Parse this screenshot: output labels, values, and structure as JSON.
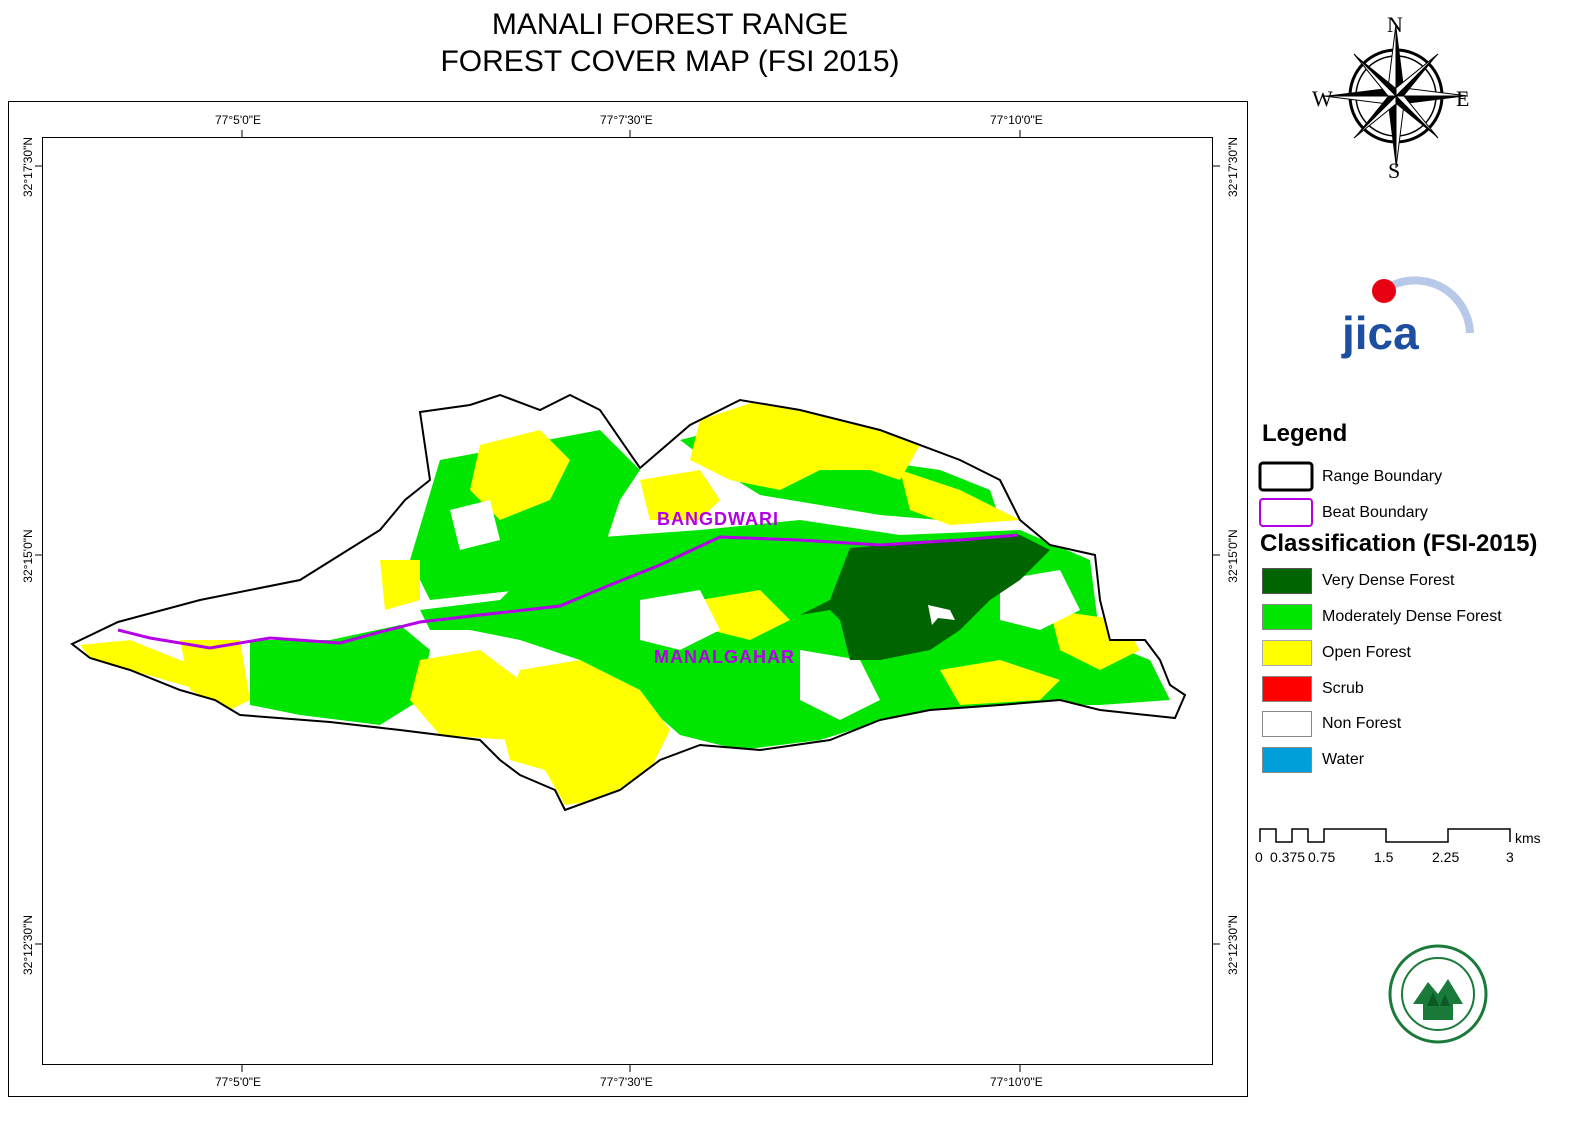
{
  "title": {
    "line1": "MANALI FOREST RANGE",
    "line2": "FOREST COVER MAP (FSI 2015)"
  },
  "grid": {
    "lon_labels": [
      "77°5'0\"E",
      "77°7'30\"E",
      "77°10'0\"E"
    ],
    "lat_labels": [
      "32°17'30\"N",
      "32°15'0\"N",
      "32°12'30\"N"
    ]
  },
  "map_labels": {
    "beat1": "BANGDWARI",
    "beat2": "MANALGAHAR"
  },
  "compass": {
    "n": "N",
    "s": "S",
    "e": "E",
    "w": "W"
  },
  "logo": {
    "text": "jica"
  },
  "legend": {
    "title": "Legend",
    "boundaries": [
      {
        "label": "Range Boundary",
        "color": "#000000"
      },
      {
        "label": "Beat Boundary",
        "color": "#b400e6"
      }
    ],
    "classification_title": "Classification (FSI-2015)",
    "classes": [
      {
        "label": "Very Dense Forest",
        "color": "#006400"
      },
      {
        "label": "Moderately Dense Forest",
        "color": "#00e600"
      },
      {
        "label": "Open Forest",
        "color": "#ffff00"
      },
      {
        "label": "Scrub",
        "color": "#ff0000"
      },
      {
        "label": "Non Forest",
        "color": "#ffffff"
      },
      {
        "label": "Water",
        "color": "#009fdc"
      }
    ]
  },
  "scale_bar": {
    "unit": "kms",
    "labels": [
      "0",
      "0.375",
      "0.75",
      "1.5",
      "2.25",
      "3"
    ]
  }
}
